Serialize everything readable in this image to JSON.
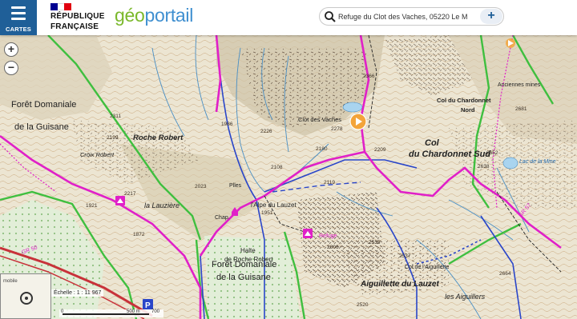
{
  "header": {
    "menu_label": "CARTES",
    "gov_line1": "RÉPUBLIQUE",
    "gov_line2": "FRANÇAISE",
    "brand_geo": "géo",
    "brand_portail": "portail",
    "flag_colors": [
      "#000091",
      "#ffffff",
      "#e1000f"
    ],
    "accent_color": "#1f5f98"
  },
  "search": {
    "value": "Refuge du Clot des Vaches, 05220 Le M",
    "icon": "search-icon",
    "add_label": "+"
  },
  "zoom": {
    "in": "+",
    "out": "−"
  },
  "map": {
    "labels": {
      "foret_domaniale_1": "Forêt Domaniale",
      "de_la_guisane_1": "de la Guisane",
      "roche_robert": "Roche Robert",
      "croix_robert": "Croix Robert",
      "la_lauziere": "la Lauzière",
      "clot_des_vaches": "Clot des Vaches",
      "col_chardonnet_sud_1": "Col",
      "col_chardonnet_sud_2": "du Chardonnet Sud",
      "col_chardonnet_nord": "Col du Chardonnet",
      "col_chardonnet_nord_2": "Nord",
      "anciennes_mines": "Anciennes mines",
      "lac_de_la_mine": "Lac de la Mine",
      "alpe_du_lauzet": "l'Alpe du Lauzet",
      "halte_roche_robert": "Halte",
      "halte_roche_robert_2": "de Roche Robert",
      "foret_domaniale_2": "Forêt Domaniale",
      "de_la_guisane_2": "de la Guisane",
      "col_aiguillette": "Col de l'Aiguillette",
      "aiguillette_du_lauzet": "Aiguillette du Lauzet",
      "les_aiguillers": "les Aiguillers",
      "plles": "Plles",
      "chap": "Chap.",
      "gr50": "GR 50",
      "gr57": "GR 57",
      "refuge_label": "Refuge"
    },
    "elevations": [
      "2311",
      "2199",
      "2217",
      "2226",
      "2278",
      "2180",
      "2108",
      "2209",
      "2023",
      "1986",
      "2119",
      "1951",
      "2638",
      "2652",
      "2681",
      "2537",
      "2535",
      "2606",
      "2520",
      "2664",
      "2366",
      "1921",
      "1872"
    ],
    "poi_color": "#f3a43a",
    "trail_color": "#e020c8",
    "road_color": "#c8323a",
    "forest_border_color": "#3fbf3f"
  },
  "minimap": {
    "label": "mobile"
  },
  "scale": {
    "label": "Échelle : 1 : 11 967",
    "tick_0": "0",
    "tick_500": "500 m",
    "tick_700": "700"
  },
  "parking_label": "P"
}
